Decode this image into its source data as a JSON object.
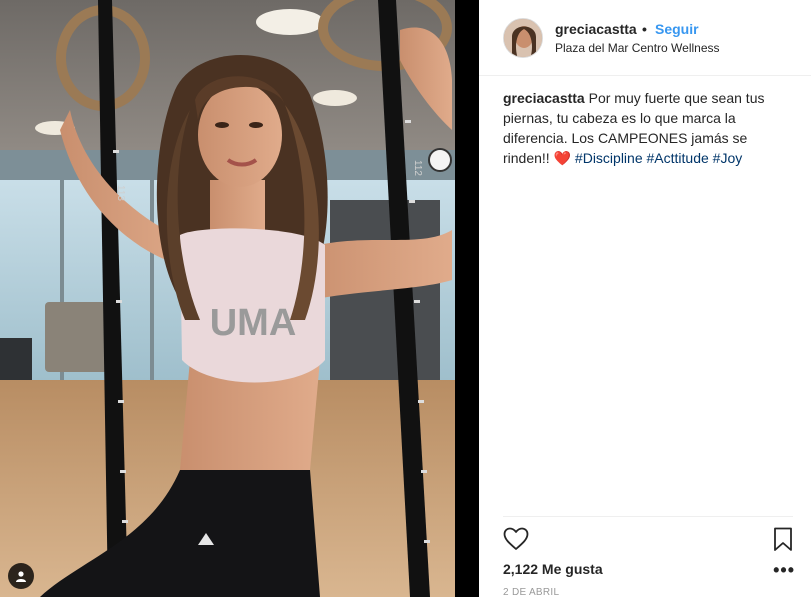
{
  "post": {
    "username": "greciacastta",
    "separator": "•",
    "follow_label": "Seguir",
    "location": "Plaza del Mar Centro Wellness",
    "caption_user": "greciacastta",
    "caption_text": " Por muy fuerte que sean tus piernas, tu cabeza es lo que marca la diferencia. Los CAMPEONES jamás se rinden!! ",
    "caption_emoji": "❤️",
    "hashtags": [
      "#Discipline",
      "#Acttitude",
      "#Joy"
    ],
    "likes": "2,122 Me gusta",
    "date": "2 DE ABRIL",
    "more_label": "•••"
  },
  "photo": {
    "top_text": "UMA",
    "strap_marks": [
      "113",
      "112"
    ]
  },
  "icons": {
    "like": "heart-outline-icon",
    "save": "bookmark-outline-icon",
    "tagged": "user-tag-icon",
    "more": "ellipsis-icon"
  },
  "colors": {
    "link_blue": "#3897f0",
    "hashtag_blue": "#003569",
    "text": "#262626",
    "muted": "#999999"
  }
}
